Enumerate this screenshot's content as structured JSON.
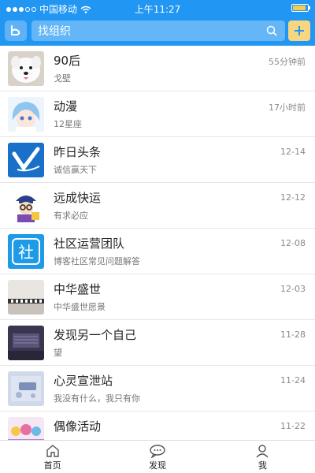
{
  "status": {
    "carrier": "中国移动",
    "time": "上午11:27",
    "signal_bars": 5,
    "signal_filled": 3,
    "battery_level": 0.9
  },
  "search": {
    "logo_icon": "app-logo-icon",
    "placeholder": "找组织",
    "search_icon": "search-icon",
    "add_icon": "plus-icon",
    "bg_color": "#2196f3",
    "accent_color": "#f6d680"
  },
  "organizations": [
    {
      "name": "90后",
      "subtitle": "戈壁",
      "time": "55分钟前",
      "avatar": "avatar-dog"
    },
    {
      "name": "动漫",
      "subtitle": "12星座",
      "time": "17小时前",
      "avatar": "avatar-anime"
    },
    {
      "name": "昨日头条",
      "subtitle": "诚信赢天下",
      "time": "12-14",
      "avatar": "avatar-logo-blue"
    },
    {
      "name": "远成快运",
      "subtitle": "有求必应",
      "time": "12-12",
      "avatar": "avatar-cartoon"
    },
    {
      "name": "社区运营团队",
      "subtitle": "博客社区常见问题解答",
      "time": "12-08",
      "avatar": "avatar-she"
    },
    {
      "name": "中华盛世",
      "subtitle": "中华盛世愿景",
      "time": "12-03",
      "avatar": "avatar-scene"
    },
    {
      "name": "发现另一个自己",
      "subtitle": "望",
      "time": "11-28",
      "avatar": "avatar-dark"
    },
    {
      "name": "心灵宣泄站",
      "subtitle": "我没有什么，我只有你",
      "time": "11-24",
      "avatar": "avatar-text"
    },
    {
      "name": "偶像活动",
      "subtitle": "",
      "time": "11-22",
      "avatar": "avatar-idols"
    }
  ],
  "tabs": [
    {
      "label": "首页",
      "icon": "home-icon"
    },
    {
      "label": "发现",
      "icon": "chat-icon"
    },
    {
      "label": "我",
      "icon": "user-icon"
    }
  ]
}
